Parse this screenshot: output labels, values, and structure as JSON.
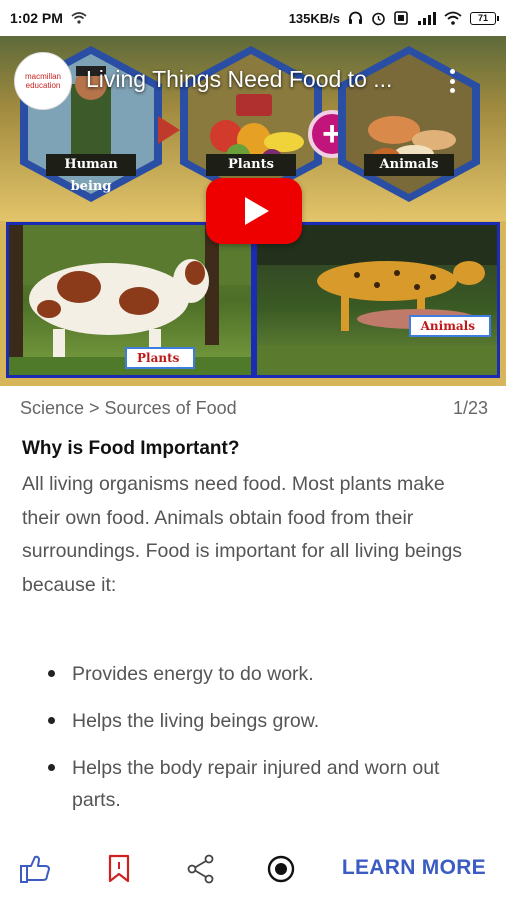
{
  "status_bar": {
    "time": "1:02 PM",
    "network_speed": "135KB/s",
    "battery": "71",
    "icons": [
      "wifi-icon",
      "headphones-icon",
      "alarm-icon",
      "data-saver-icon",
      "signal-icon",
      "wifi-icon",
      "battery-icon"
    ]
  },
  "video": {
    "title": "Living Things Need Food to ...",
    "channel_logo_text": "macmillan education",
    "hex_labels": [
      "Human being",
      "Plants",
      "Animals"
    ],
    "panel_tags": {
      "plants": "Plants",
      "animals": "Animals"
    },
    "play_icon": "play-icon",
    "accent_color": "#ee0000"
  },
  "content": {
    "breadcrumb": "Science > Sources of Food",
    "page_counter": "1/23",
    "section_title": "Why is Food Important?",
    "intro": "All living organisms need food. Most plants make their own food. Animals obtain food from their surroundings. Food is important for all living beings because it:",
    "bullets": [
      "Provides energy to do work.",
      "Helps the living beings grow.",
      "Helps the body repair injured and worn out parts."
    ]
  },
  "action_bar": {
    "learn_more_label": "LEARN MORE",
    "icons": [
      "like-icon",
      "bookmark-icon",
      "share-icon",
      "record-icon"
    ],
    "colors": {
      "like": "#3c5cc4",
      "bookmark": "#d02020",
      "share": "#444444",
      "record": "#111111",
      "learn_more": "#3c5cc4"
    }
  }
}
